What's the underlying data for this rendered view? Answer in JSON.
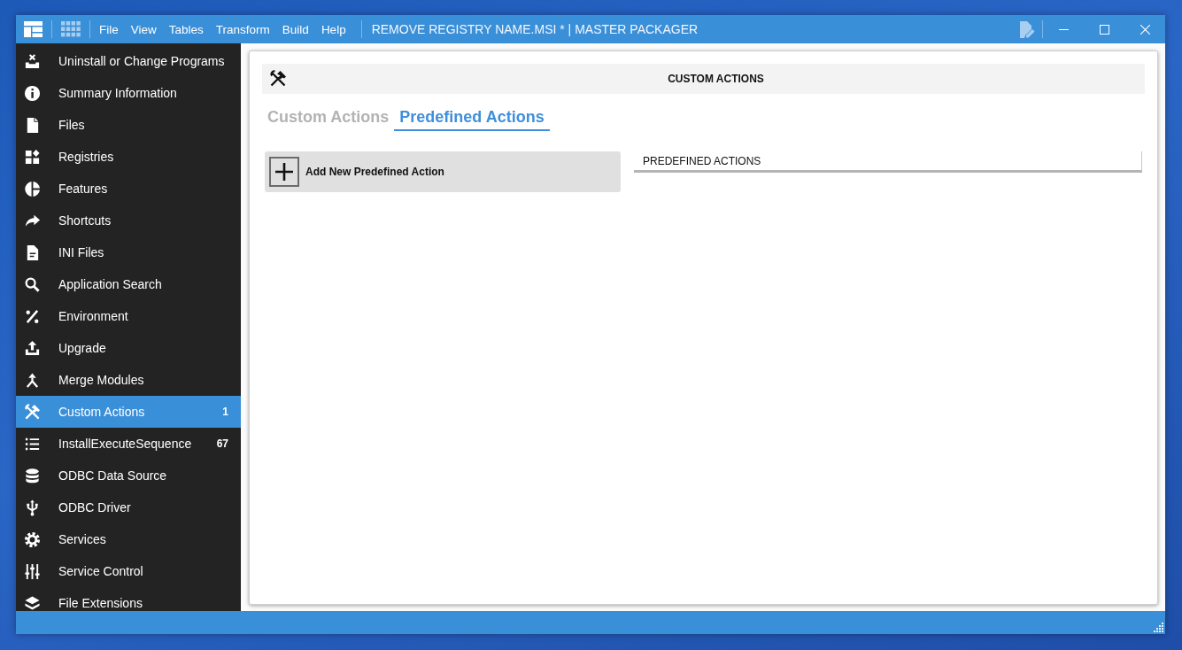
{
  "window": {
    "title": "REMOVE REGISTRY NAME.MSI * | MASTER PACKAGER"
  },
  "menu": [
    "File",
    "View",
    "Tables",
    "Transform",
    "Build",
    "Help"
  ],
  "sidebar": {
    "items": [
      {
        "label": "Uninstall or Change Programs",
        "selected": false
      },
      {
        "label": "Summary Information",
        "selected": false
      },
      {
        "label": "Files",
        "selected": false
      },
      {
        "label": "Registries",
        "selected": false
      },
      {
        "label": "Features",
        "selected": false
      },
      {
        "label": "Shortcuts",
        "selected": false
      },
      {
        "label": "INI Files",
        "selected": false
      },
      {
        "label": "Application Search",
        "selected": false
      },
      {
        "label": "Environment",
        "selected": false
      },
      {
        "label": "Upgrade",
        "selected": false
      },
      {
        "label": "Merge Modules",
        "selected": false
      },
      {
        "label": "Custom Actions",
        "selected": true,
        "count": "1"
      },
      {
        "label": "InstallExecuteSequence",
        "selected": false,
        "count": "67"
      },
      {
        "label": "ODBC Data Source",
        "selected": false
      },
      {
        "label": "ODBC Driver",
        "selected": false
      },
      {
        "label": "Services",
        "selected": false
      },
      {
        "label": "Service Control",
        "selected": false
      },
      {
        "label": "File Extensions",
        "selected": false
      }
    ]
  },
  "panel": {
    "title": "CUSTOM ACTIONS",
    "tabs": [
      {
        "label": "Custom Actions",
        "selected": false
      },
      {
        "label": "Predefined Actions",
        "selected": true
      }
    ],
    "add_button": "Add New Predefined Action",
    "list": {
      "header": "PREDEFINED ACTIONS"
    }
  }
}
